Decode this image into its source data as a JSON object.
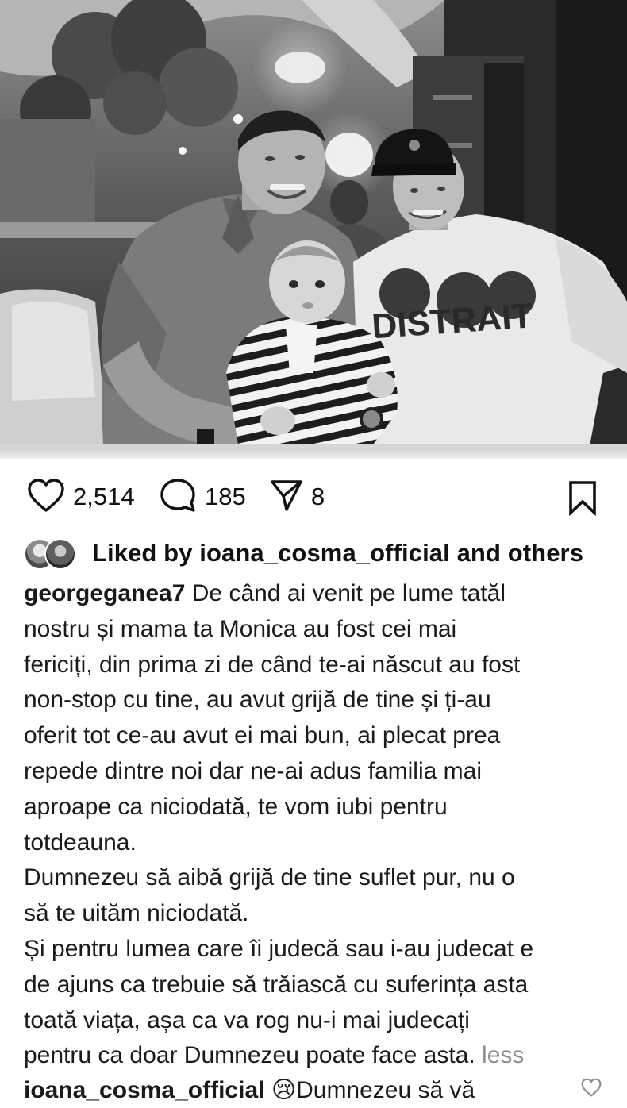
{
  "post": {
    "photo_alt": "",
    "likes_count": "2,514",
    "comments_count": "185",
    "shares_count": "8"
  },
  "liked_by": {
    "prefix": "Liked by ",
    "user": "ioana_cosma_official",
    "suffix": " and others"
  },
  "caption": {
    "username": "georgeganea7",
    "lines": [
      " De când ai venit pe lume tatăl",
      "nostru și mama ta Monica au fost cei mai",
      "fericiți, din prima zi de când te-ai născut au fost",
      "non-stop cu tine, au avut grijă de tine și ți-au",
      "oferit tot ce-au avut ei mai bun, ai plecat prea",
      "repede dintre noi dar ne-ai adus familia mai",
      "aproape ca niciodată, te vom iubi pentru",
      "totdeauna.",
      "Dumnezeu să aibă grijă de tine suflet pur, nu o",
      "să te uităm niciodată.",
      "Și pentru lumea care îi judecă sau i-au judecat e",
      "de ajuns ca trebuie să trăiască cu suferința asta",
      "toată viața, așa ca va rog nu-i mai judecați",
      "pentru ca doar Dumnezeu poate face asta. "
    ],
    "less_label": "less"
  },
  "next_comment": {
    "username": "ioana_cosma_official",
    "emoji": "😢",
    "text": "Dumnezeu să vă"
  },
  "icons": {
    "like": "heart-outline-icon",
    "comment": "comment-bubble-icon",
    "share": "paper-plane-icon",
    "save": "bookmark-outline-icon"
  },
  "colors": {
    "text": "#111111",
    "muted": "#8e8e8e",
    "background": "#ffffff"
  }
}
